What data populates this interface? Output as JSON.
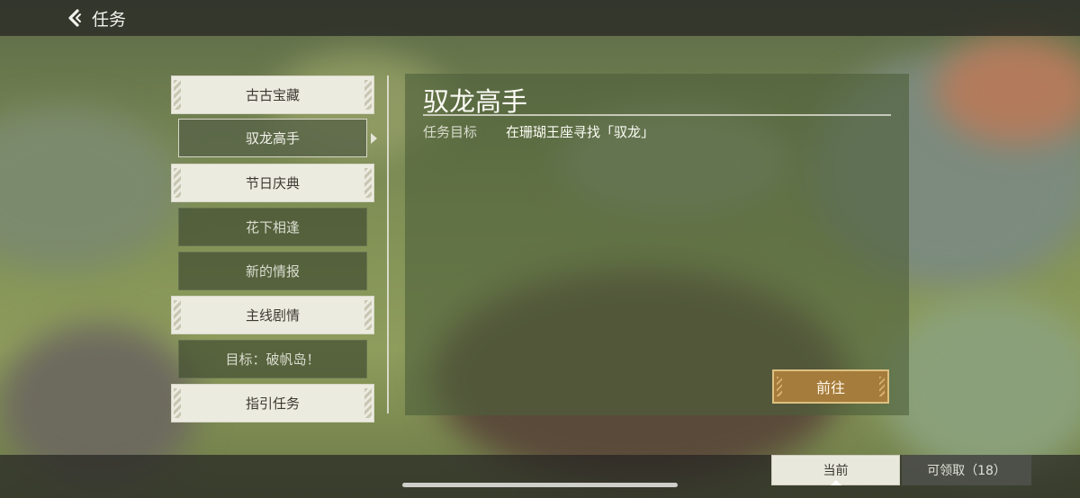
{
  "header": {
    "title": "任务"
  },
  "quest_list": {
    "items": [
      {
        "label": "古古宝藏",
        "style": "normal"
      },
      {
        "label": "驭龙高手",
        "style": "selected"
      },
      {
        "label": "节日庆典",
        "style": "normal"
      },
      {
        "label": "花下相逢",
        "style": "dark"
      },
      {
        "label": "新的情报",
        "style": "dark"
      },
      {
        "label": "主线剧情",
        "style": "normal"
      },
      {
        "label": "目标：破帆岛！",
        "style": "dark"
      },
      {
        "label": "指引任务",
        "style": "normal"
      }
    ]
  },
  "detail": {
    "title": "驭龙高手",
    "goal_label": "任务目标",
    "goal_text": "在珊瑚王座寻找「驭龙」",
    "go_button_label": "前往"
  },
  "tabs": {
    "current_label": "当前",
    "claimable_label": "可领取（18）"
  },
  "icons": {
    "back": "chevron-left-icon"
  },
  "colors": {
    "button_gold": "#a57c3c",
    "list_item_light": "#ecebdf",
    "panel_green": "#4e603a"
  }
}
